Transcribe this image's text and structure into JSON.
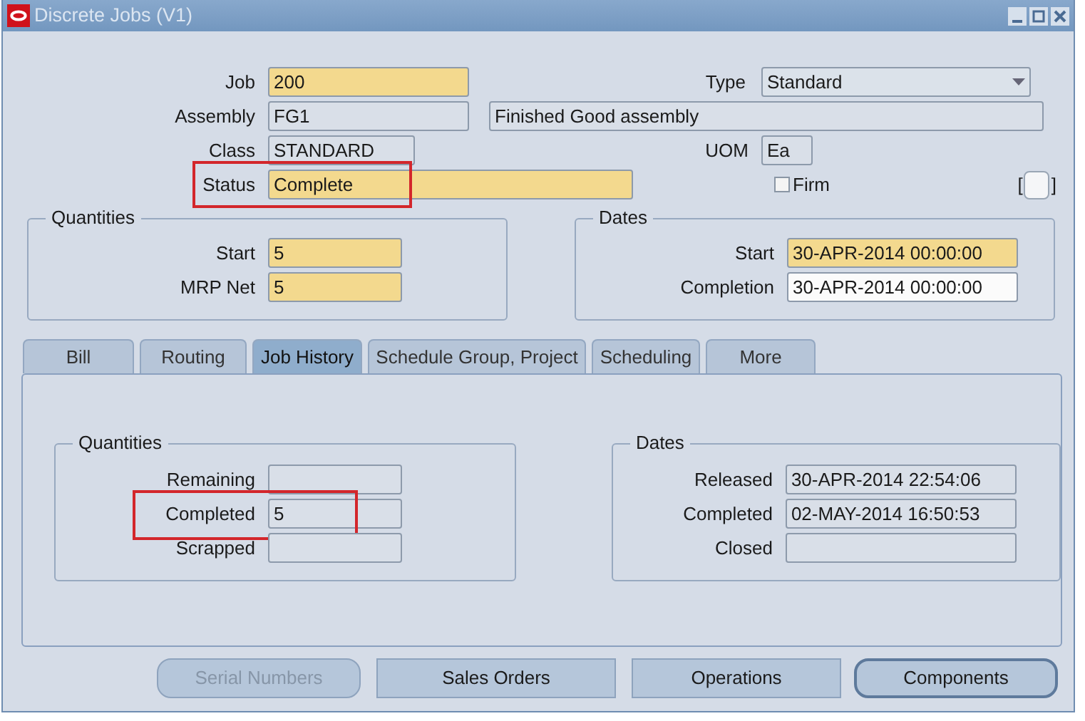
{
  "window": {
    "title": "Discrete Jobs (V1)"
  },
  "header": {
    "job": {
      "label": "Job",
      "value": "200",
      "kind": "required"
    },
    "type": {
      "label": "Type",
      "value": "Standard",
      "kind": "select"
    },
    "assembly": {
      "label": "Assembly",
      "value": "FG1",
      "kind": "readonly"
    },
    "assembly_description": {
      "value": "Finished Good assembly",
      "kind": "readonly"
    },
    "class": {
      "label": "Class",
      "value": "STANDARD",
      "kind": "readonly"
    },
    "uom": {
      "label": "UOM",
      "value": "Ea",
      "kind": "readonly"
    },
    "status": {
      "label": "Status",
      "value": "Complete",
      "kind": "required",
      "highlighted": true
    },
    "firm": {
      "label": "Firm",
      "checked": false
    },
    "flexfield": {
      "open": "[",
      "close": "]"
    }
  },
  "quantities": {
    "title": "Quantities",
    "fields": [
      {
        "label": "Start",
        "value": "5",
        "kind": "required"
      },
      {
        "label": "MRP Net",
        "value": "5",
        "kind": "required"
      }
    ]
  },
  "dates": {
    "title": "Dates",
    "fields": [
      {
        "label": "Start",
        "value": "30-APR-2014 00:00:00",
        "kind": "required"
      },
      {
        "label": "Completion",
        "value": "30-APR-2014 00:00:00",
        "kind": "editable"
      }
    ]
  },
  "tabs": [
    {
      "label": "Bill",
      "selected": false
    },
    {
      "label": "Routing",
      "selected": false
    },
    {
      "label": "Job History",
      "selected": true
    },
    {
      "label": "Schedule Group, Project",
      "selected": false
    },
    {
      "label": "Scheduling",
      "selected": false
    },
    {
      "label": "More",
      "selected": false
    }
  ],
  "job_history": {
    "quantities": {
      "title": "Quantities",
      "fields": [
        {
          "label": "Remaining",
          "kind": "readonly",
          "highlighted": false
        },
        {
          "label": "Completed",
          "value": "5",
          "kind": "readonly",
          "highlighted": true
        },
        {
          "label": "Scrapped",
          "kind": "readonly",
          "highlighted": false
        }
      ]
    },
    "dates": {
      "title": "Dates",
      "fields": [
        {
          "label": "Released",
          "value": "30-APR-2014 22:54:06",
          "kind": "readonly"
        },
        {
          "label": "Completed",
          "value": "02-MAY-2014 16:50:53",
          "kind": "readonly"
        },
        {
          "label": "Closed",
          "kind": "readonly"
        }
      ]
    }
  },
  "buttons": [
    {
      "label": "Serial Numbers",
      "disabled": true,
      "default": false
    },
    {
      "label": "Sales Orders",
      "disabled": false,
      "default": false
    },
    {
      "label": "Operations",
      "disabled": false,
      "default": false
    },
    {
      "label": "Components",
      "disabled": false,
      "default": true
    }
  ]
}
